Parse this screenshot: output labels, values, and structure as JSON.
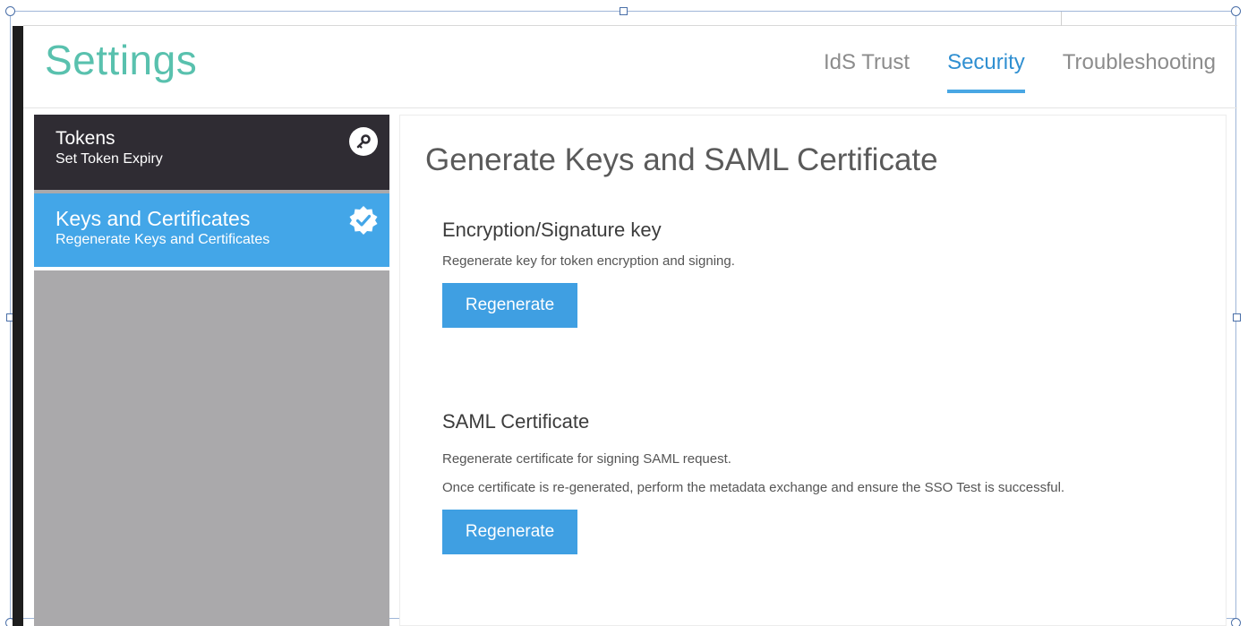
{
  "header": {
    "title": "Settings",
    "tabs": [
      {
        "label": "IdS Trust",
        "active": false
      },
      {
        "label": "Security",
        "active": true
      },
      {
        "label": "Troubleshooting",
        "active": false
      }
    ]
  },
  "sidebar": {
    "items": [
      {
        "title": "Tokens",
        "subtitle": "Set Token Expiry",
        "icon": "key-icon",
        "selected": false
      },
      {
        "title": "Keys and Certificates",
        "subtitle": "Regenerate Keys and Certificates",
        "icon": "verified-badge-icon",
        "selected": true
      }
    ]
  },
  "main": {
    "title": "Generate Keys and SAML Certificate",
    "sections": [
      {
        "title": "Encryption/Signature key",
        "lines": [
          "Regenerate key for token encryption and signing."
        ],
        "button": "Regenerate"
      },
      {
        "title": "SAML Certificate",
        "lines": [
          "Regenerate certificate for signing SAML request.",
          "Once certificate is re-generated, perform the metadata exchange and ensure the SSO Test is successful."
        ],
        "button": "Regenerate"
      }
    ]
  },
  "colors": {
    "title": "#59c1ae",
    "accent": "#43a6e8",
    "sidebar_dark": "#2f2c33",
    "sidebar_bg": "#aaa9ab"
  }
}
